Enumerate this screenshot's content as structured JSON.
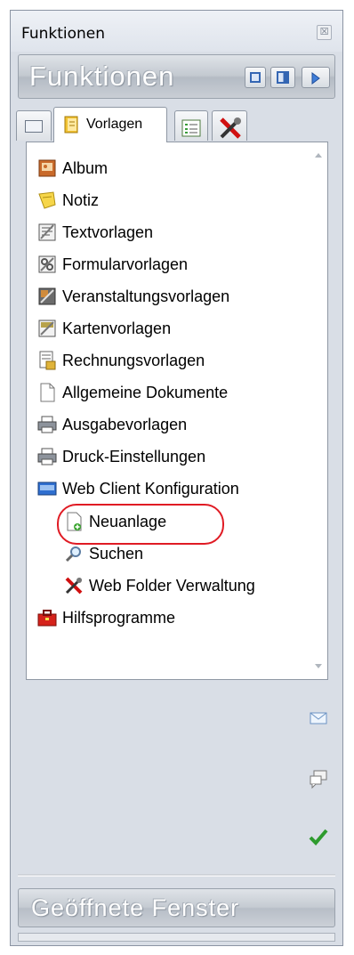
{
  "window": {
    "title": "Funktionen",
    "close_glyph": "☒"
  },
  "panel": {
    "header_title": "Funktionen",
    "header_buttons": [
      "layout-single-icon",
      "layout-split-icon",
      "pin-icon"
    ]
  },
  "tabs": [
    {
      "label": "",
      "icon": "preview-icon"
    },
    {
      "label": "Vorlagen",
      "icon": "book-icon",
      "active": true
    },
    {
      "label": "",
      "icon": "list-icon"
    },
    {
      "label": "",
      "icon": "tools-icon"
    }
  ],
  "tree": {
    "items": [
      {
        "label": "Album",
        "icon": "album-icon"
      },
      {
        "label": "Notiz",
        "icon": "note-icon"
      },
      {
        "label": "Textvorlagen",
        "icon": "text-template-icon"
      },
      {
        "label": "Formularvorlagen",
        "icon": "form-template-icon"
      },
      {
        "label": "Veranstaltungsvorlagen",
        "icon": "event-template-icon"
      },
      {
        "label": "Kartenvorlagen",
        "icon": "card-template-icon"
      },
      {
        "label": "Rechnungsvorlagen",
        "icon": "invoice-template-icon"
      },
      {
        "label": "Allgemeine Dokumente",
        "icon": "document-icon"
      },
      {
        "label": "Ausgabevorlagen",
        "icon": "printer-icon"
      },
      {
        "label": "Druck-Einstellungen",
        "icon": "printer-icon"
      },
      {
        "label": "Web Client Konfiguration",
        "icon": "web-client-icon"
      },
      {
        "label": "Neuanlage",
        "icon": "new-document-icon"
      },
      {
        "label": "Suchen",
        "icon": "search-icon"
      },
      {
        "label": "Web Folder Verwaltung",
        "icon": "tools-icon"
      },
      {
        "label": "Hilfsprogramme",
        "icon": "toolbox-icon"
      }
    ]
  },
  "actions": [
    "mail-icon",
    "chat-icon",
    "checkmark-icon"
  ],
  "footer": {
    "title": "Geöffnete Fenster"
  },
  "colors": {
    "highlight": "#e01b24",
    "header_text": "#ffffff"
  }
}
